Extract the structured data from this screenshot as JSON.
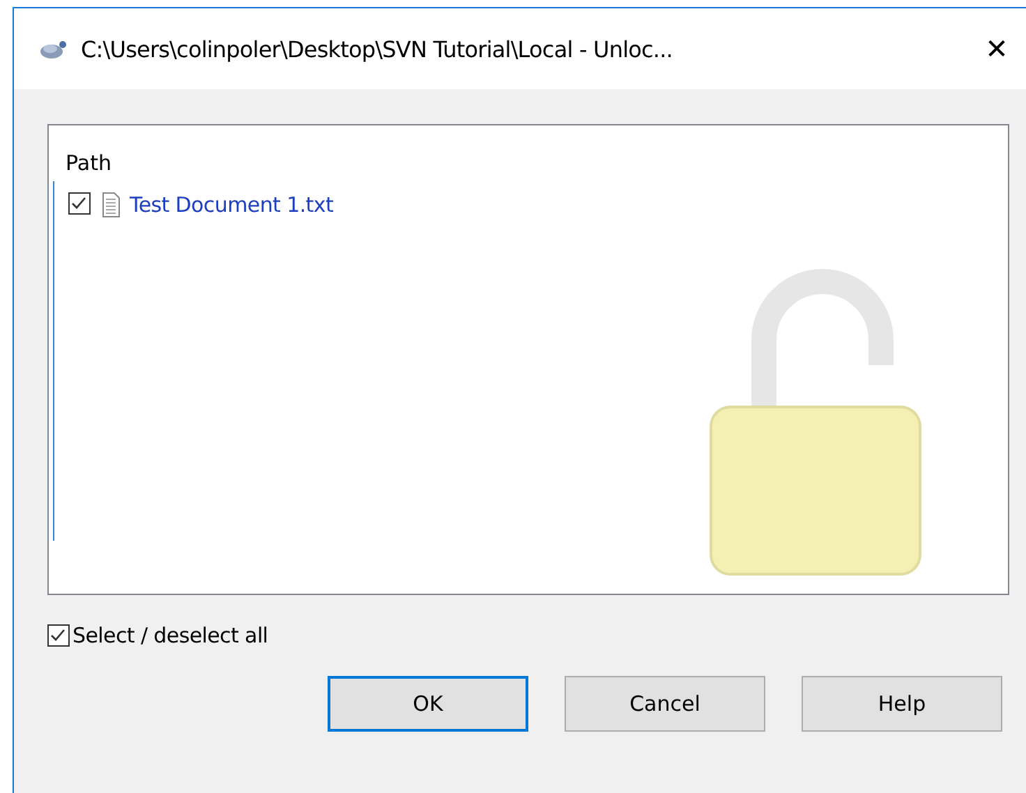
{
  "window": {
    "title": "C:\\Users\\colinpoler\\Desktop\\SVN Tutorial\\Local - Unloc...",
    "close": "✕"
  },
  "file_list": {
    "columns": [
      {
        "label": "Path"
      }
    ],
    "rows": [
      {
        "name": "Test Document 1.txt",
        "checked": true
      }
    ]
  },
  "select_all": {
    "label": "Select / deselect all",
    "checked": true
  },
  "buttons": [
    {
      "label": "OK",
      "default": true
    },
    {
      "label": "Cancel",
      "default": false
    },
    {
      "label": "Help",
      "default": false
    }
  ]
}
